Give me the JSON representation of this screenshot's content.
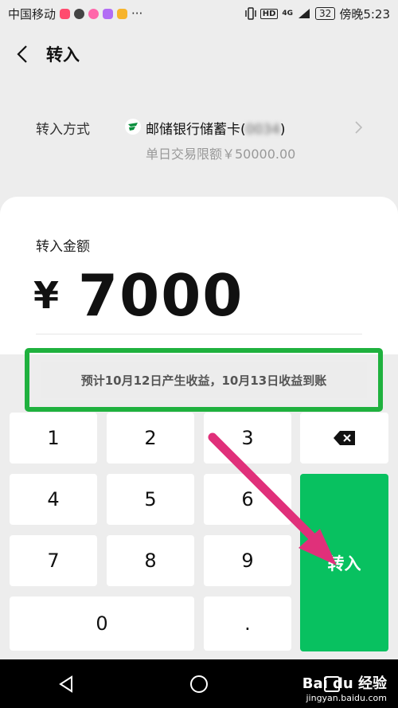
{
  "status_bar": {
    "carrier": "中国移动",
    "signal": "4G",
    "hd": "HD",
    "battery": "32",
    "time": "傍晚5:23",
    "more": "···"
  },
  "header": {
    "title": "转入"
  },
  "method": {
    "label": "转入方式",
    "bank": "邮储银行储蓄卡(",
    "card_suffix": "0034",
    "bank_close": ")",
    "limit": "单日交易限额￥50000.00"
  },
  "amount": {
    "label": "转入金额",
    "currency": "¥",
    "value": "7000"
  },
  "notice": "预计10月12日产生收益，10月13日收益到账",
  "keypad": {
    "k1": "1",
    "k2": "2",
    "k3": "3",
    "k4": "4",
    "k5": "5",
    "k6": "6",
    "k7": "7",
    "k8": "8",
    "k9": "9",
    "k0": "0",
    "dot": ".",
    "confirm": "转入"
  },
  "watermark": {
    "brand": "Bai du 经验",
    "url": "jingyan.baidu.com"
  },
  "colors": {
    "accent": "#08c160",
    "highlight": "#1fb13e",
    "arrow": "#e0307a"
  }
}
